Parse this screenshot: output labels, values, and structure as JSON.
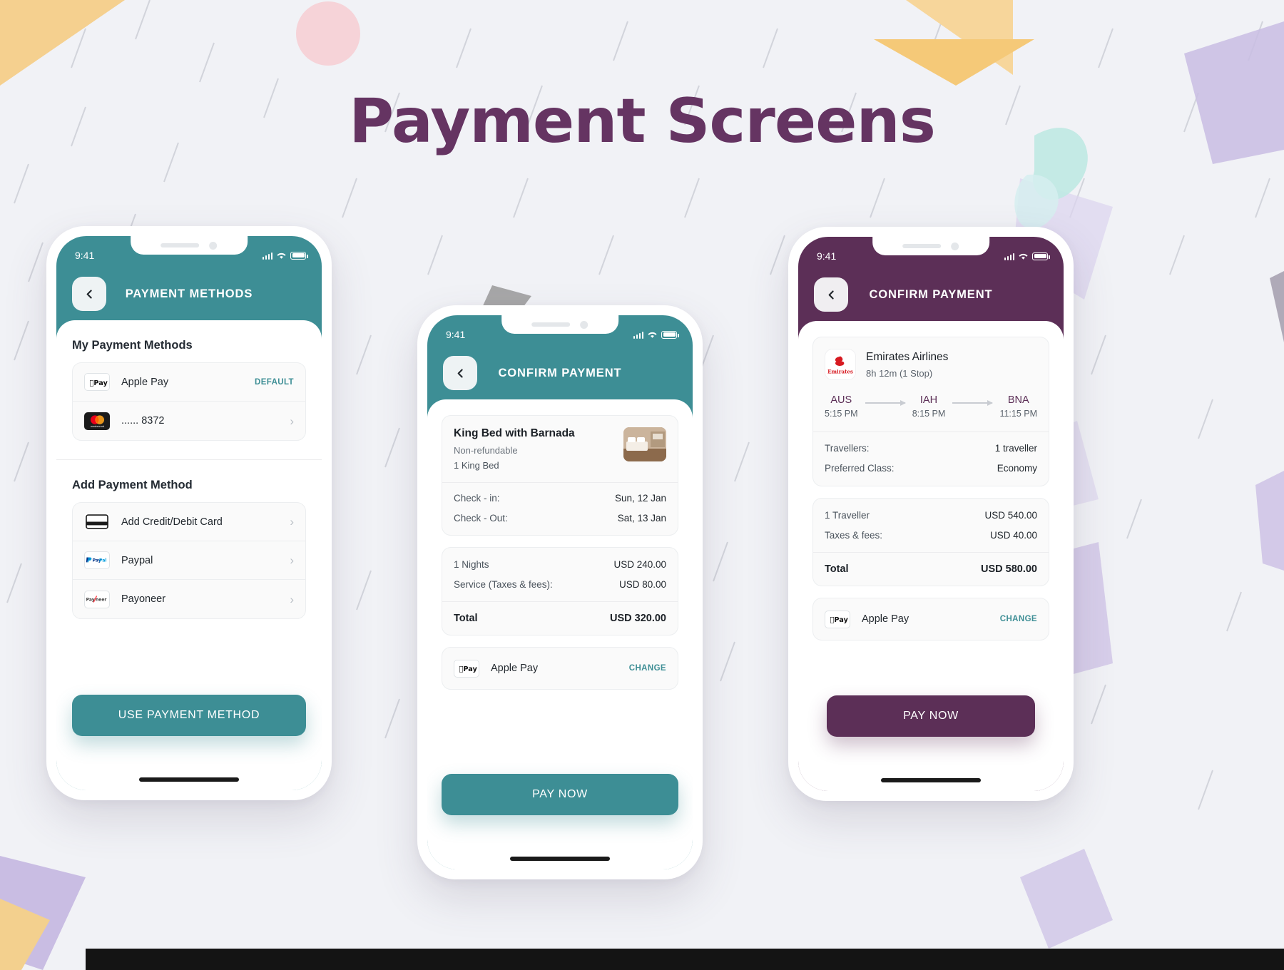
{
  "page": {
    "title": "Payment Screens",
    "accent_teal": "#3d8e95",
    "accent_purple": "#5c2f57"
  },
  "phone1": {
    "status": {
      "time": "9:41"
    },
    "appbar": {
      "title": "PAYMENT METHODS",
      "back_icon": "chevron-left-icon"
    },
    "my_methods": {
      "heading": "My Payment Methods",
      "items": [
        {
          "icon": "apple-pay-icon",
          "label": "Apple Pay",
          "badge": "DEFAULT"
        },
        {
          "icon": "mastercard-icon",
          "label": "...... 8372",
          "badge": ""
        }
      ]
    },
    "add_methods": {
      "heading": "Add Payment Method",
      "items": [
        {
          "icon": "credit-card-icon",
          "label": "Add Credit/Debit Card"
        },
        {
          "icon": "paypal-icon",
          "label": "Paypal"
        },
        {
          "icon": "payoneer-icon",
          "label": "Payoneer"
        }
      ]
    },
    "cta": "USE PAYMENT METHOD"
  },
  "phone2": {
    "status": {
      "time": "9:41"
    },
    "appbar": {
      "title": "CONFIRM PAYMENT",
      "back_icon": "chevron-left-icon"
    },
    "room": {
      "name": "King Bed with Barnada",
      "refund": "Non-refundable",
      "beds": "1 King Bed",
      "checkin_label": "Check - in:",
      "checkin_value": "Sun, 12 Jan",
      "checkout_label": "Check - Out:",
      "checkout_value": "Sat, 13 Jan"
    },
    "price": {
      "rows": [
        {
          "label": "1 Nights",
          "value": "USD 240.00"
        },
        {
          "label": "Service (Taxes & fees):",
          "value": "USD 80.00"
        }
      ],
      "total_label": "Total",
      "total_value": "USD 320.00"
    },
    "payment": {
      "icon": "apple-pay-icon",
      "label": "Apple Pay",
      "action": "CHANGE"
    },
    "cta": "PAY NOW"
  },
  "phone3": {
    "status": {
      "time": "9:41"
    },
    "appbar": {
      "title": "CONFIRM PAYMENT",
      "back_icon": "chevron-left-icon"
    },
    "flight": {
      "airline": "Emirates Airlines",
      "duration": "8h 12m (1 Stop)",
      "logo_text": "Emirates",
      "from_code": "AUS",
      "from_time": "5:15 PM",
      "mid_code": "IAH",
      "mid_time": "8:15 PM",
      "to_code": "BNA",
      "to_time": "11:15 PM",
      "travellers_label": "Travellers:",
      "travellers_value": "1 traveller",
      "class_label": "Preferred Class:",
      "class_value": "Economy"
    },
    "price": {
      "rows": [
        {
          "label": "1 Traveller",
          "value": "USD 540.00"
        },
        {
          "label": "Taxes & fees:",
          "value": "USD 40.00"
        }
      ],
      "total_label": "Total",
      "total_value": "USD 580.00"
    },
    "payment": {
      "icon": "apple-pay-icon",
      "label": "Apple Pay",
      "action": "CHANGE"
    },
    "cta": "PAY NOW"
  }
}
